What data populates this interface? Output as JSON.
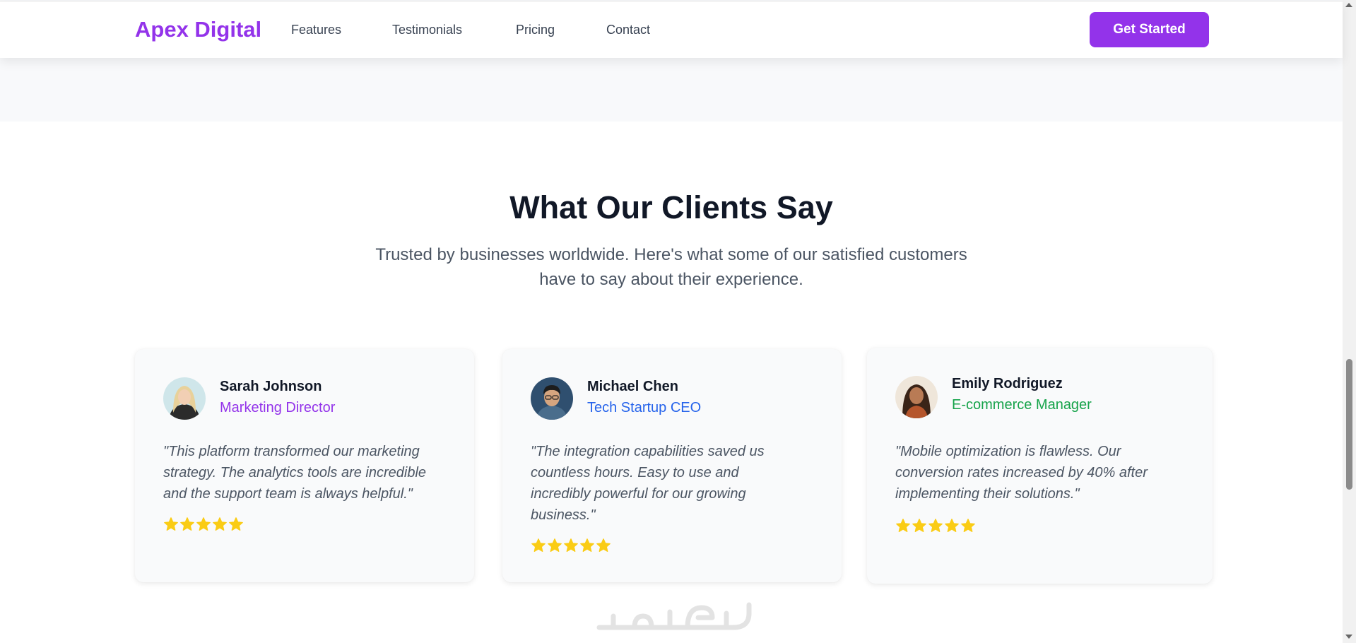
{
  "header": {
    "brand": "Apex Digital",
    "nav": [
      {
        "label": "Features"
      },
      {
        "label": "Testimonials"
      },
      {
        "label": "Pricing"
      },
      {
        "label": "Contact"
      }
    ],
    "cta_label": "Get Started"
  },
  "testimonials_section": {
    "title": "What Our Clients Say",
    "subtitle_line1": "Trusted by businesses worldwide. Here's what some of our satisfied customers",
    "subtitle_line2": "have to say about their experience.",
    "cards": [
      {
        "name": "Sarah Johnson",
        "role": "Marketing Director",
        "role_color": "#9333ea",
        "quote_lines": [
          "\"This platform transformed our marketing",
          "strategy. The analytics tools are incredible",
          "and the support team is always helpful.\""
        ],
        "rating": 5
      },
      {
        "name": "Michael Chen",
        "role": "Tech Startup CEO",
        "role_color": "#2563eb",
        "quote_lines": [
          "\"The integration capabilities saved us",
          "countless hours. Easy to use and",
          "incredibly powerful for our growing",
          "business.\""
        ],
        "rating": 5
      },
      {
        "name": "Emily Rodriguez",
        "role": "E-commerce Manager",
        "role_color": "#16a34a",
        "quote_lines": [
          "\"Mobile optimization is flawless. Our",
          "conversion rates increased by 40% after",
          "implementing their solutions.\""
        ],
        "rating": 5
      }
    ]
  },
  "colors": {
    "brand": "#9333ea",
    "star": "#facc15"
  },
  "watermark": "خمسات"
}
